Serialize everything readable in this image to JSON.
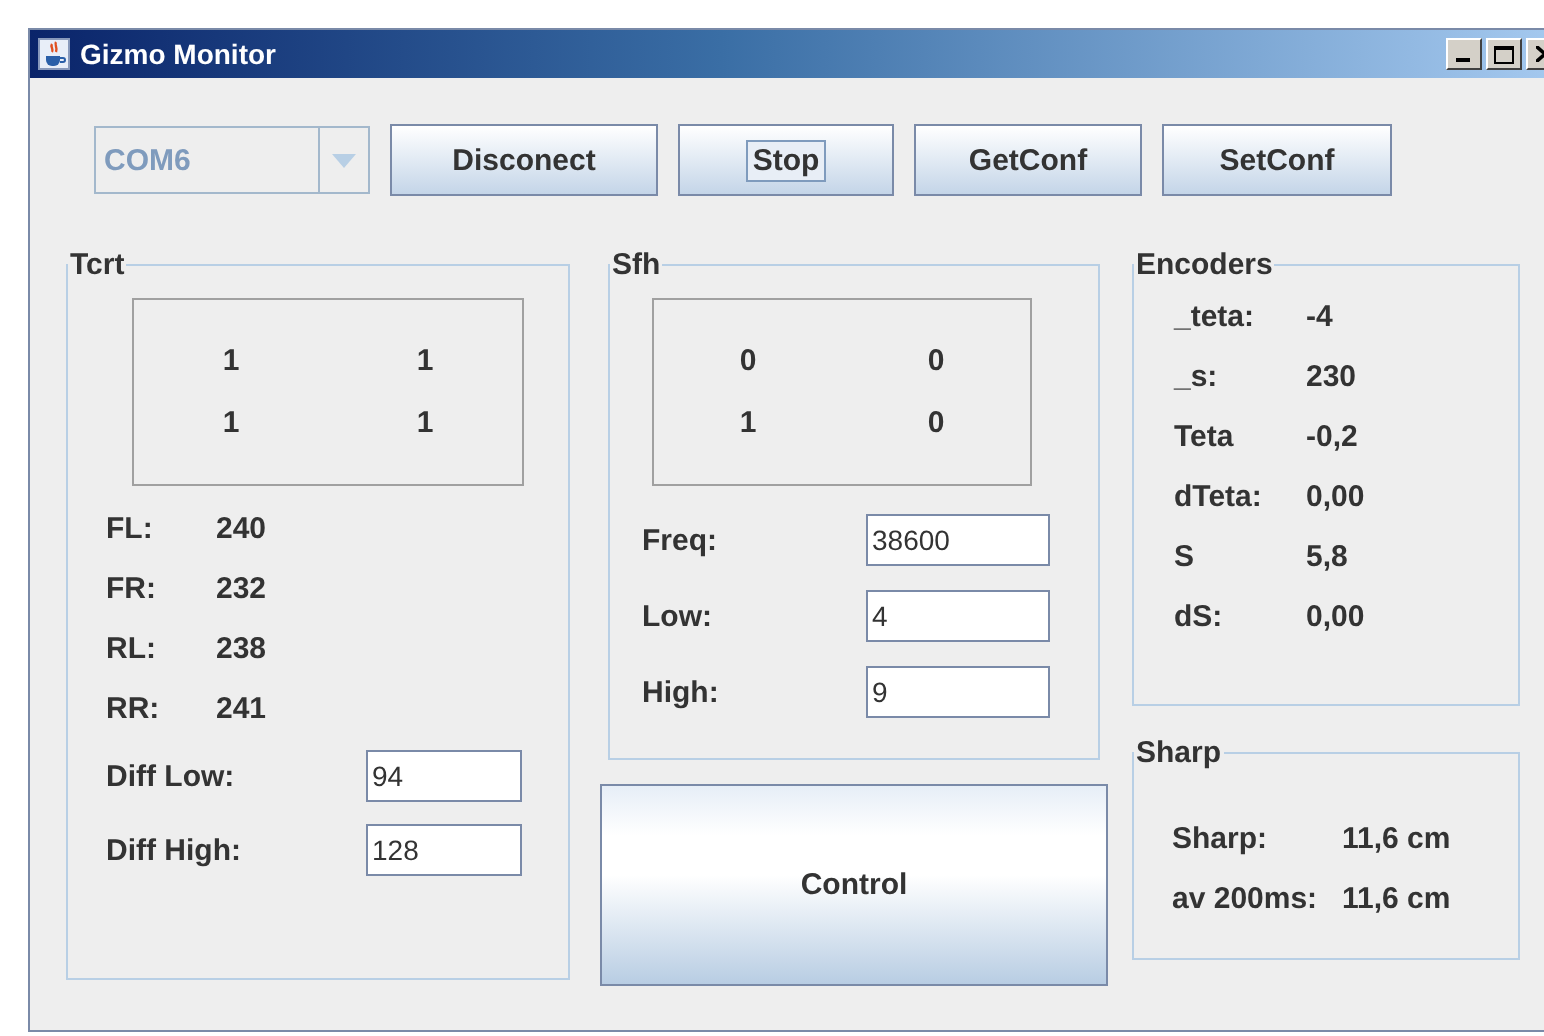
{
  "window": {
    "title": "Gizmo Monitor"
  },
  "toolbar": {
    "port": {
      "value": "COM6",
      "disabled": true
    },
    "buttons": [
      {
        "label": "Disconect",
        "focused": false
      },
      {
        "label": "Stop",
        "focused": true
      },
      {
        "label": "GetConf",
        "focused": false
      },
      {
        "label": "SetConf",
        "focused": false
      }
    ]
  },
  "tcrt": {
    "title": "Tcrt",
    "matrix": [
      [
        "1",
        "1"
      ],
      [
        "1",
        "1"
      ]
    ],
    "readings": [
      {
        "label": "FL:",
        "value": "240"
      },
      {
        "label": "FR:",
        "value": "232"
      },
      {
        "label": "RL:",
        "value": "238"
      },
      {
        "label": "RR:",
        "value": "241"
      }
    ],
    "fields": [
      {
        "label": "Diff Low:",
        "value": "94"
      },
      {
        "label": "Diff High:",
        "value": "128"
      }
    ]
  },
  "sfh": {
    "title": "Sfh",
    "matrix": [
      [
        "0",
        "0"
      ],
      [
        "1",
        "0"
      ]
    ],
    "fields": [
      {
        "label": "Freq:",
        "value": "38600"
      },
      {
        "label": "Low:",
        "value": "4"
      },
      {
        "label": "High:",
        "value": "9"
      }
    ]
  },
  "control_button": "Control",
  "encoders": {
    "title": "Encoders",
    "readings": [
      {
        "label": "_teta:",
        "value": "-4"
      },
      {
        "label": "_s:",
        "value": "230"
      },
      {
        "label": "Teta",
        "value": "-0,2"
      },
      {
        "label": "dTeta:",
        "value": "0,00"
      },
      {
        "label": "S",
        "value": "5,8"
      },
      {
        "label": "dS:",
        "value": "0,00"
      }
    ]
  },
  "sharp": {
    "title": "Sharp",
    "readings": [
      {
        "label": "Sharp:",
        "value": "11,6 cm"
      },
      {
        "label": "av 200ms:",
        "value": "11,6 cm"
      }
    ]
  }
}
